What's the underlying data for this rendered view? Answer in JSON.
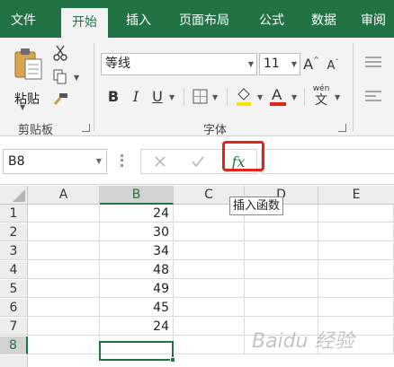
{
  "tabs": [
    {
      "label": "文件",
      "active": false
    },
    {
      "label": "开始",
      "active": true
    },
    {
      "label": "插入",
      "active": false
    },
    {
      "label": "页面布局",
      "active": false
    },
    {
      "label": "公式",
      "active": false
    },
    {
      "label": "数据",
      "active": false
    },
    {
      "label": "审阅",
      "active": false
    }
  ],
  "clipboard": {
    "paste_label": "粘贴",
    "group_label": "剪贴板"
  },
  "font": {
    "name": "等线",
    "size": "11",
    "group_label": "字体",
    "phonetic_top": "wén",
    "phonetic_bottom": "文"
  },
  "formula_bar": {
    "name_box": "B8",
    "function_icon": "fx",
    "value": ""
  },
  "tooltip": "插入函数",
  "columns": [
    "A",
    "B",
    "C",
    "D",
    "E"
  ],
  "selected_column": "B",
  "rows": [
    {
      "num": "1",
      "b": "24"
    },
    {
      "num": "2",
      "b": "30"
    },
    {
      "num": "3",
      "b": "34"
    },
    {
      "num": "4",
      "b": "48"
    },
    {
      "num": "5",
      "b": "49"
    },
    {
      "num": "6",
      "b": "45"
    },
    {
      "num": "7",
      "b": "24"
    },
    {
      "num": "8",
      "b": ""
    }
  ],
  "selected_row": "8",
  "watermark": "Baidu 经验",
  "colors": {
    "accent": "#217346",
    "highlight": "#e3241b",
    "ribbon_bg": "#f3f3f3"
  }
}
